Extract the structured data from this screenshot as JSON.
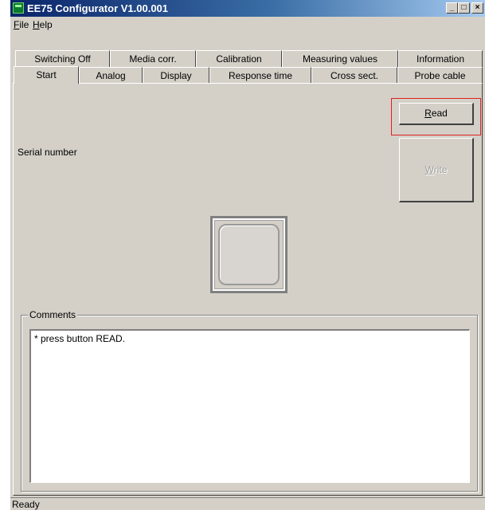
{
  "window": {
    "title": "EE75 Configurator V1.00.001",
    "controls": {
      "minimize": "_",
      "maximize": "□",
      "close": "×"
    }
  },
  "menu": {
    "file": {
      "first": "F",
      "rest": "ile"
    },
    "help": {
      "first": "H",
      "rest": "elp"
    }
  },
  "tabs": {
    "row1": [
      "Switching Off",
      "Media corr.",
      "Calibration",
      "Measuring values",
      "Information"
    ],
    "row2": [
      "Start",
      "Analog",
      "Display",
      "Response time",
      "Cross sect.",
      "Probe cable"
    ],
    "active": "Start"
  },
  "panel": {
    "serial_label": "Serial number",
    "read_button": {
      "first": "R",
      "rest": "ead"
    },
    "write_button": {
      "first": "W",
      "rest": "rite"
    },
    "comments_title": "Comments",
    "comments_text": "* press button READ."
  },
  "status": {
    "text": "Ready"
  },
  "colors": {
    "face": "#d4d0c8",
    "title_start": "#0a246a",
    "title_end": "#a6caf0",
    "highlight": "#e02020"
  }
}
